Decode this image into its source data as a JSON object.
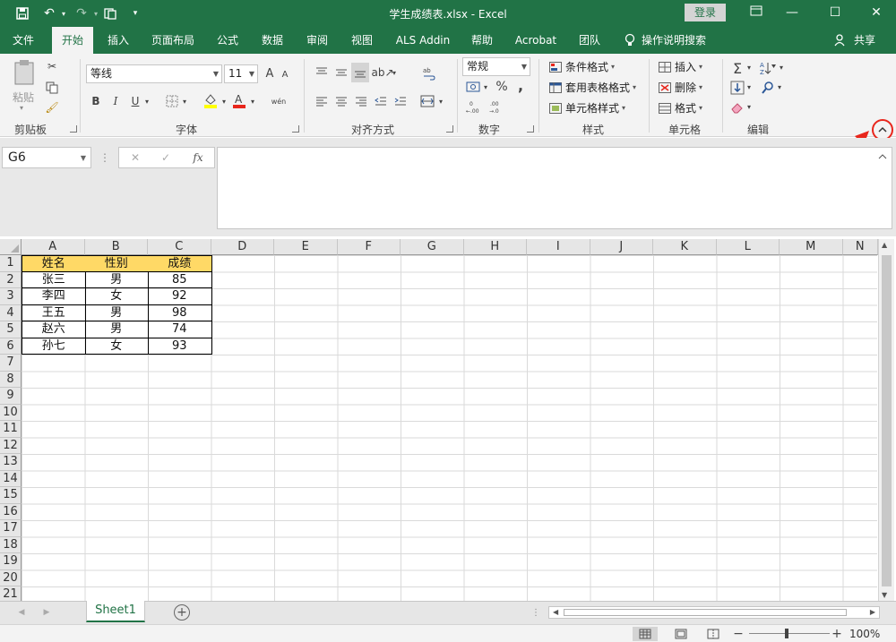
{
  "titlebar": {
    "title": "学生成绩表.xlsx  -  Excel",
    "login": "登录"
  },
  "menu": {
    "file": "文件",
    "home": "开始",
    "insert": "插入",
    "page_layout": "页面布局",
    "formulas": "公式",
    "data": "数据",
    "review": "审阅",
    "view": "视图",
    "als_addin": "ALS Addin",
    "help": "帮助",
    "acrobat": "Acrobat",
    "team": "团队",
    "tell_me": "操作说明搜索",
    "share": "共享"
  },
  "ribbon": {
    "clipboard": {
      "paste": "粘贴",
      "label": "剪贴板"
    },
    "font": {
      "name": "等线",
      "size": "11",
      "label": "字体",
      "bold": "B",
      "italic": "I",
      "underline": "U",
      "grow": "A",
      "shrink": "A",
      "phonetic": "wén"
    },
    "alignment": {
      "label": "对齐方式"
    },
    "number": {
      "format": "常规",
      "label": "数字",
      "percent": "%",
      "comma": ","
    },
    "styles": {
      "conditional": "条件格式",
      "table": "套用表格格式",
      "cell_styles": "单元格样式",
      "label": "样式"
    },
    "cells": {
      "insert": "插入",
      "delete": "删除",
      "format": "格式",
      "label": "单元格"
    },
    "editing": {
      "label": "编辑"
    }
  },
  "formula_bar": {
    "name_box": "G6",
    "fx": "fx",
    "content": ""
  },
  "columns": [
    "A",
    "B",
    "C",
    "D",
    "E",
    "F",
    "G",
    "H",
    "I",
    "J",
    "K",
    "L",
    "M",
    "N"
  ],
  "rows": [
    "1",
    "2",
    "3",
    "4",
    "5",
    "6",
    "7",
    "8",
    "9",
    "10",
    "11",
    "12",
    "13",
    "14",
    "15",
    "16",
    "17",
    "18",
    "19",
    "20",
    "21"
  ],
  "table": {
    "headers": [
      "姓名",
      "性别",
      "成绩"
    ],
    "rows": [
      [
        "张三",
        "男",
        "85"
      ],
      [
        "李四",
        "女",
        "92"
      ],
      [
        "王五",
        "男",
        "98"
      ],
      [
        "赵六",
        "男",
        "74"
      ],
      [
        "孙七",
        "女",
        "93"
      ]
    ]
  },
  "sheets": {
    "active": "Sheet1"
  },
  "status": {
    "zoom": "100%"
  },
  "colors": {
    "excel_green": "#217346",
    "header_fill": "#ffd966",
    "annotation_red": "#e8261c"
  }
}
